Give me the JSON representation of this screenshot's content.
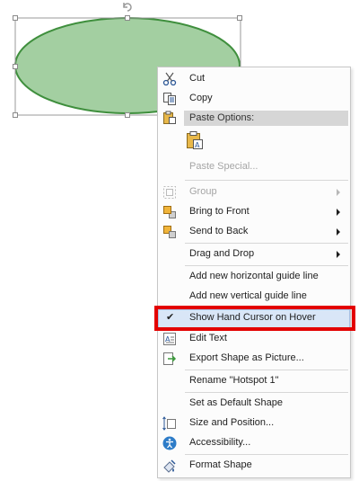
{
  "menu": {
    "items": [
      {
        "id": "cut",
        "label": "Cut",
        "enabled": true,
        "icon": "scissors-icon"
      },
      {
        "id": "copy",
        "label": "Copy",
        "enabled": true,
        "icon": "copy-icon"
      },
      {
        "id": "paste-options",
        "label": "Paste Options:",
        "header": true,
        "icon": "clipboard-icon"
      },
      {
        "id": "paste-special",
        "label": "Paste Special...",
        "enabled": false
      },
      {
        "id": "group",
        "label": "Group",
        "enabled": false,
        "submenu": true,
        "icon": "group-icon"
      },
      {
        "id": "bring-to-front",
        "label": "Bring to Front",
        "enabled": true,
        "submenu": true,
        "icon": "bring-front-icon"
      },
      {
        "id": "send-to-back",
        "label": "Send to Back",
        "enabled": true,
        "submenu": true,
        "icon": "send-back-icon"
      },
      {
        "id": "drag-and-drop",
        "label": "Drag and Drop",
        "enabled": true,
        "submenu": true
      },
      {
        "id": "add-h-guide",
        "label": "Add new horizontal guide line",
        "enabled": true
      },
      {
        "id": "add-v-guide",
        "label": "Add new vertical guide line",
        "enabled": true
      },
      {
        "id": "show-hand-cursor",
        "label": "Show Hand Cursor on Hover",
        "enabled": true,
        "checked": true,
        "highlighted": true,
        "check_mark": "✔"
      },
      {
        "id": "edit-text",
        "label": "Edit Text",
        "enabled": true,
        "icon": "edit-text-icon"
      },
      {
        "id": "export-shape",
        "label": "Export Shape as Picture...",
        "enabled": true,
        "icon": "export-icon"
      },
      {
        "id": "rename",
        "label": "Rename \"Hotspot 1\"",
        "enabled": true
      },
      {
        "id": "set-default",
        "label": "Set as Default Shape",
        "enabled": true
      },
      {
        "id": "size-position",
        "label": "Size and Position...",
        "enabled": true,
        "icon": "size-position-icon"
      },
      {
        "id": "accessibility",
        "label": "Accessibility...",
        "enabled": true,
        "icon": "accessibility-icon"
      },
      {
        "id": "format-shape",
        "label": "Format Shape",
        "enabled": true,
        "icon": "format-shape-icon"
      }
    ]
  },
  "colors": {
    "shape_fill": "#a3cfa1",
    "shape_stroke": "#3f8f3d",
    "highlight": "#d9e6f7",
    "annotation": "#e30000"
  }
}
